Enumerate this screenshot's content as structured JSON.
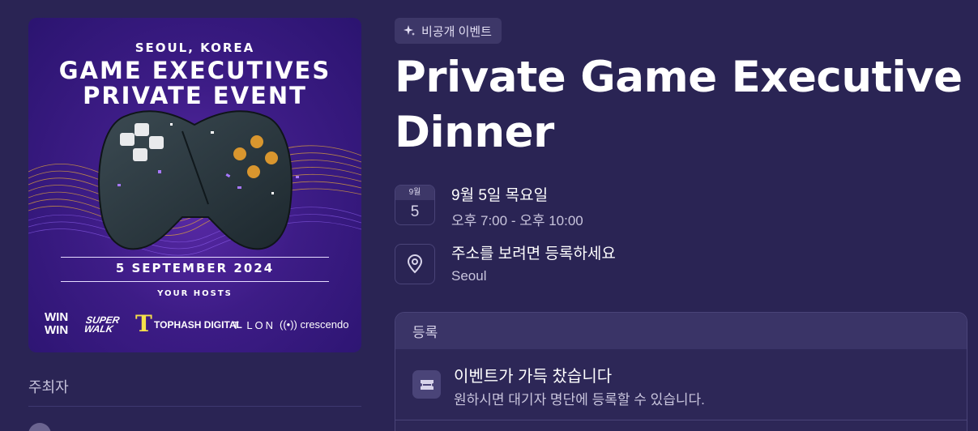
{
  "cover": {
    "city": "SEOUL, KOREA",
    "headline_line1": "GAME EXECUTIVES",
    "headline_line2": "PRIVATE EVENT",
    "date": "5 SEPTEMBER 2024",
    "hosts_label": "YOUR HOSTS",
    "logos": {
      "winwin_line1": "WIN",
      "winwin_line2": "WIN",
      "superwalk_line1": "SUPER",
      "superwalk_line2": "WALK",
      "tophash_mark": "T",
      "tophash": "TOPHASH DIGITAL",
      "talon": "T LON",
      "crescendo": "crescendo"
    }
  },
  "hosts": {
    "section_label": "주최자"
  },
  "event": {
    "badge": "비공개 이벤트",
    "title": "Private Game Executive Dinner",
    "date": {
      "month": "9월",
      "day": "5",
      "full_date": "9월 5일 목요일",
      "time": "오후 7:00 - 오후 10:00"
    },
    "location": {
      "prompt": "주소를 보려면 등록하세요",
      "city": "Seoul"
    }
  },
  "registration": {
    "header": "등록",
    "status_title": "이벤트가 가득 찼습니다",
    "status_subtitle": "원하시면 대기자 명단에 등록할 수 있습니다."
  },
  "colors": {
    "background": "#2a2454",
    "card_header": "#3a3467",
    "border": "#4a4478",
    "accent_gold": "#e0a53a"
  }
}
